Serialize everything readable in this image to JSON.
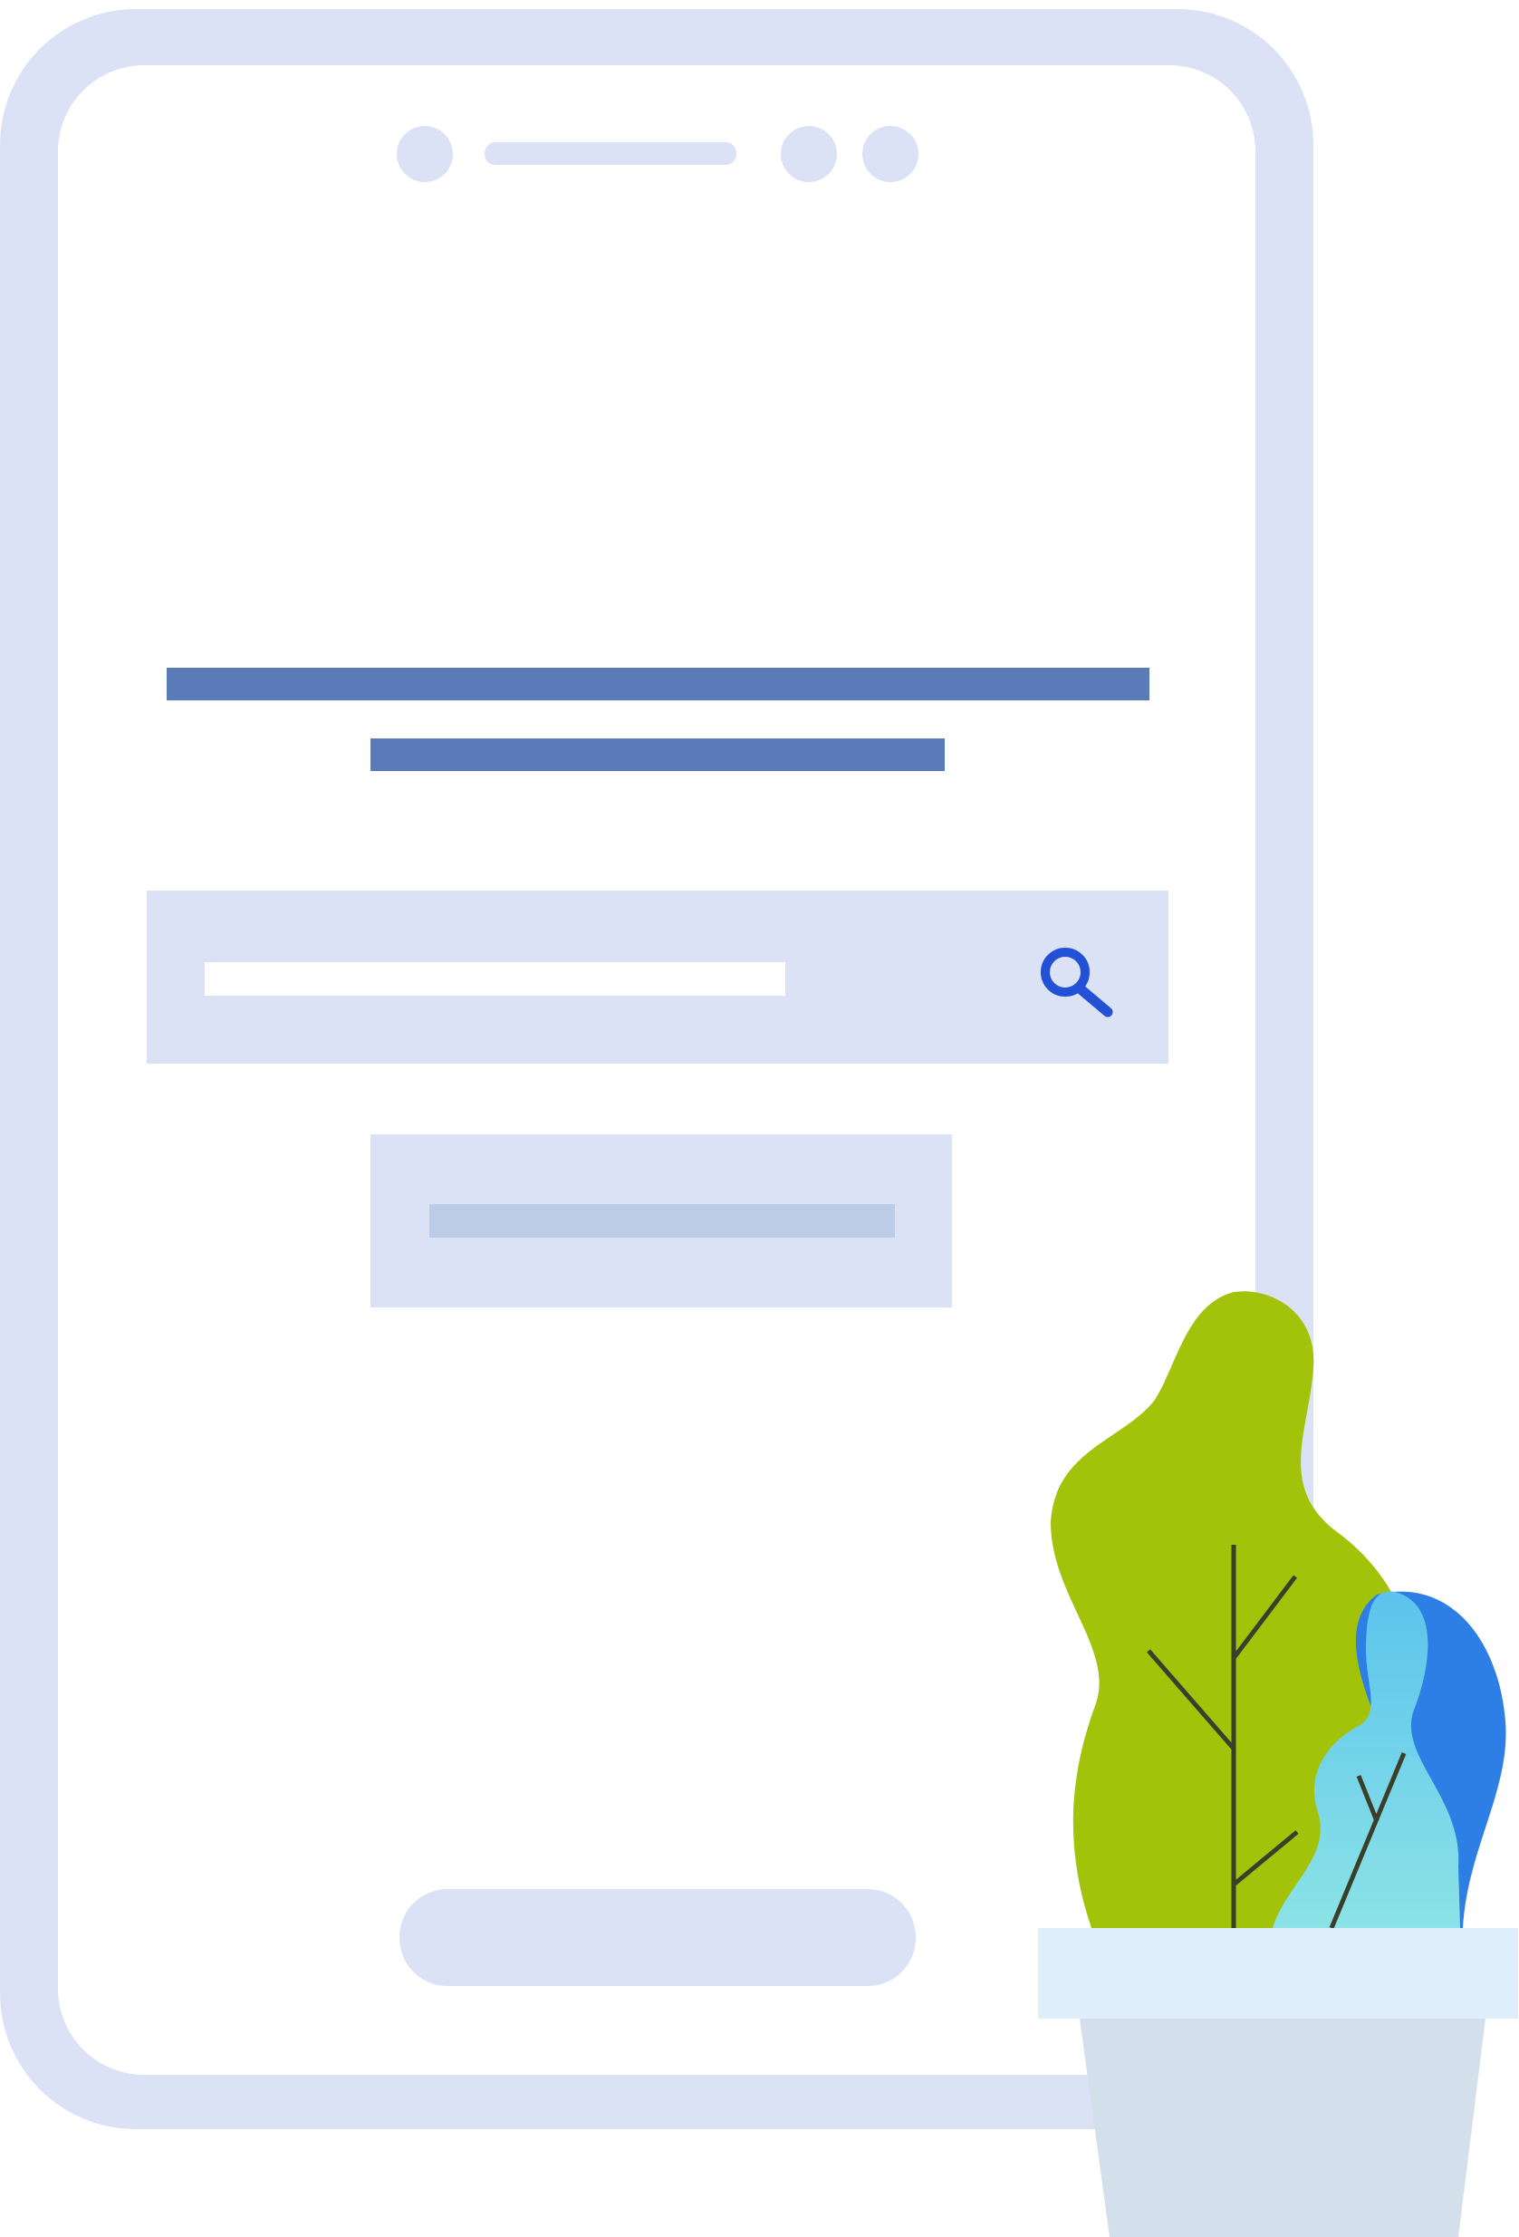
{
  "colors": {
    "background": "#ffffff",
    "phone_frame": "#dce2f5",
    "screen": "#ffffff",
    "heading_bar": "#5b7bb8",
    "input_fill": "#dce2f5",
    "input_placeholder_bar": "#ffffff",
    "search_icon": "#2250d6",
    "button_fill": "#dce2f5",
    "button_label_bar": "#bccbe6",
    "home_indicator": "#dce2f5",
    "leaf_green": "#a3c20a",
    "leaf_vein": "#3a3f2a",
    "leaf_blue": "#2d7fe6",
    "leaf_cyan_top": "#5bc3ec",
    "leaf_cyan_bottom": "#8be3e6",
    "pot_rim": "#e0eef9",
    "pot_body": "#d3e0ec"
  },
  "icons": {
    "search": "search-icon"
  }
}
